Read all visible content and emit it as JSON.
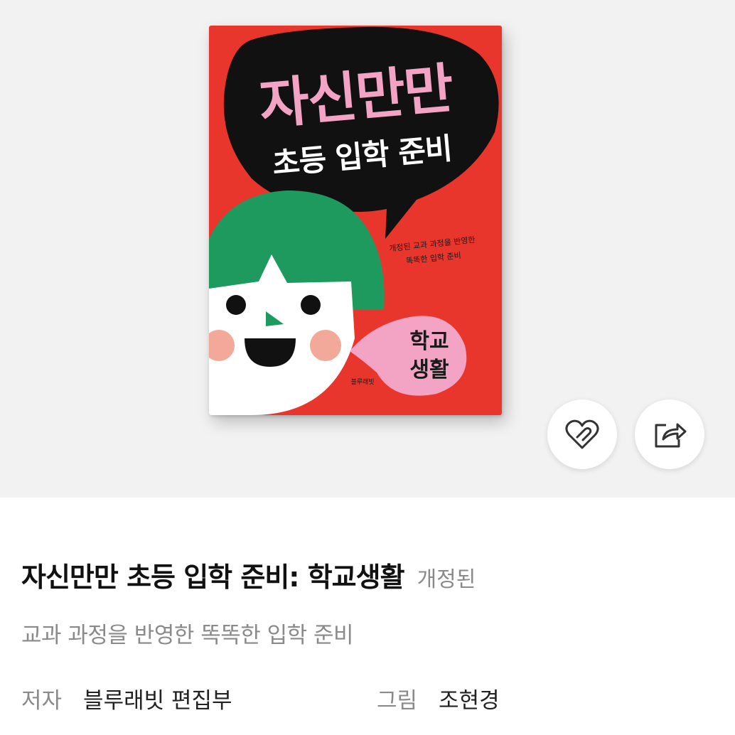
{
  "cover": {
    "title": "자신만만",
    "subtitle": "초등 입학 준비",
    "tagline_line1": "개정된 교과 과정을 반영한",
    "tagline_line2": "똑똑한 입학 준비",
    "bubble_line1": "학교",
    "bubble_line2": "생활",
    "publisher": "블루래빗",
    "colors": {
      "background": "#e8362d",
      "title": "#f3a4c5",
      "hair": "#1e9a5e",
      "bubble": "#f3a4c5",
      "cheeks": "#f3a99a"
    }
  },
  "actions": {
    "like_icon": "heart-icon",
    "share_icon": "share-icon"
  },
  "book": {
    "title": "자신만만 초등 입학 준비: 학교생활",
    "edition": "개정된",
    "subtitle": "교과 과정을 반영한 똑똑한 입학 준비"
  },
  "credits": {
    "author_label": "저자",
    "author": "블루래빗 편집부",
    "illustrator_label": "그림",
    "illustrator": "조현경"
  }
}
